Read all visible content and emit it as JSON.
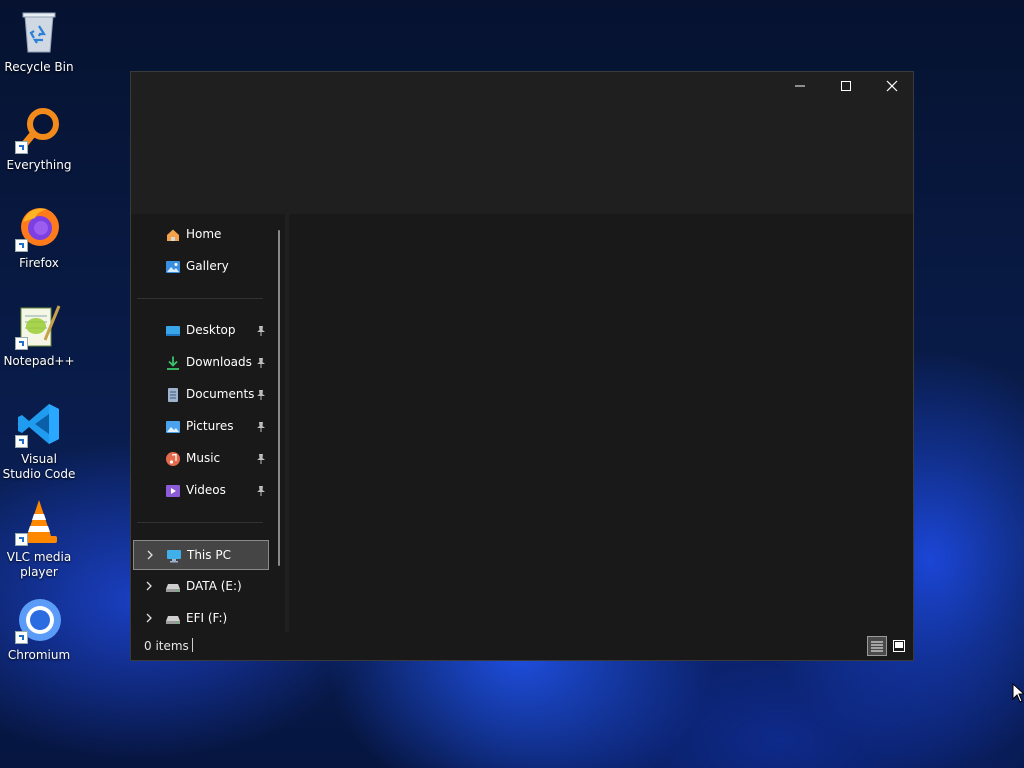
{
  "desktop": {
    "icons": [
      {
        "label": "Recycle Bin",
        "icon": "recycle-bin-icon"
      },
      {
        "label": "Everything",
        "icon": "everything-search-icon"
      },
      {
        "label": "Firefox",
        "icon": "firefox-icon"
      },
      {
        "label": "Notepad++",
        "icon": "notepad-plus-plus-icon"
      },
      {
        "label": "Visual Studio Code",
        "icon": "vscode-icon"
      },
      {
        "label": "VLC media player",
        "icon": "vlc-icon"
      },
      {
        "label": "Chromium",
        "icon": "chromium-icon"
      }
    ]
  },
  "explorer": {
    "nav": {
      "home": "Home",
      "gallery": "Gallery",
      "quick_access": [
        {
          "label": "Desktop",
          "pinned": true
        },
        {
          "label": "Downloads",
          "pinned": true
        },
        {
          "label": "Documents",
          "pinned": true
        },
        {
          "label": "Pictures",
          "pinned": true
        },
        {
          "label": "Music",
          "pinned": true
        },
        {
          "label": "Videos",
          "pinned": true
        }
      ],
      "drives": [
        {
          "label": "This PC",
          "selected": true
        },
        {
          "label": "DATA (E:)",
          "selected": false
        },
        {
          "label": "EFI (F:)",
          "selected": false
        }
      ]
    },
    "status": {
      "items_count": "0 items"
    }
  },
  "colors": {
    "window_bg": "#191919",
    "titlebar_bg": "#1f1f1f",
    "selected_bg": "#454545",
    "accent": "#0078d4"
  }
}
